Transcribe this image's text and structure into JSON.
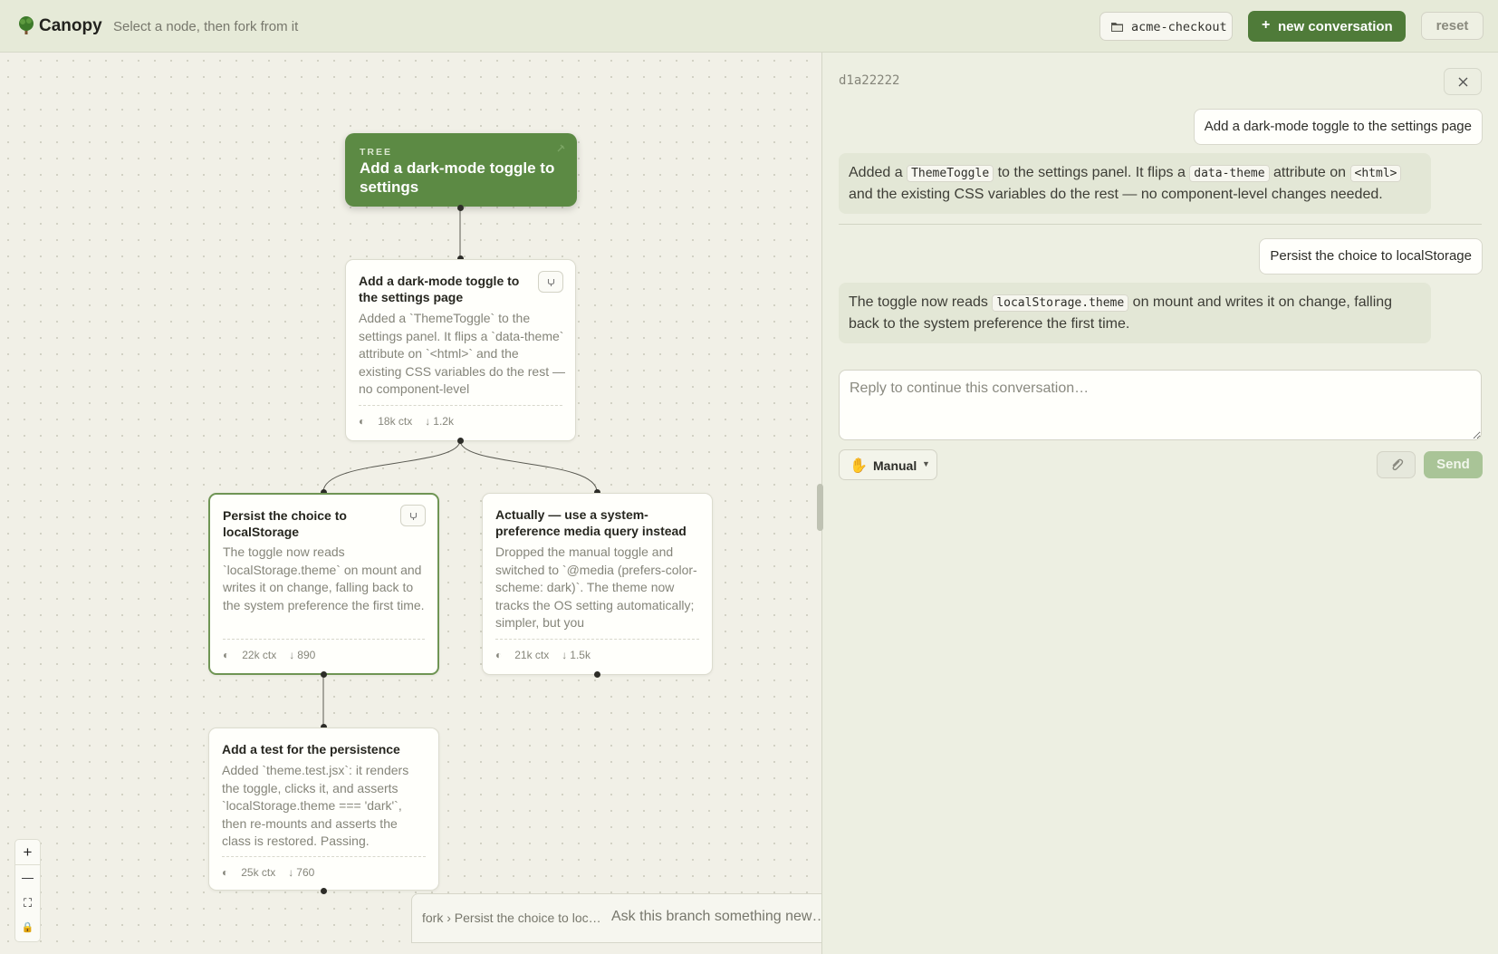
{
  "header": {
    "app_name": "Canopy",
    "hint": "Select a node, then fork from it",
    "repo_label": "acme-checkout",
    "new_conversation_label": "new conversation",
    "new_conversation_icon": "+",
    "reset_label": "reset",
    "logo_icon": "tree-icon"
  },
  "tree": {
    "root": {
      "tag": "TREE",
      "title": "Add a dark-mode toggle to settings"
    },
    "nodes": [
      {
        "title": "Add a dark-mode toggle to the settings page",
        "body": "Added a `ThemeToggle` to the settings panel. It flips a `data-theme` attribute on `<html>` and the existing CSS variables do the rest — no component-level",
        "ctx": "18k ctx",
        "tokens": "1.2k"
      },
      {
        "title": "Persist the choice to localStorage",
        "body": "The toggle now reads `localStorage.theme` on mount and writes it on change, falling back to the system preference the first time.",
        "ctx": "22k ctx",
        "tokens": "890",
        "selected": true
      },
      {
        "title": "Actually — use a system-preference media query instead",
        "body": "Dropped the manual toggle and switched to `@media (prefers-color-scheme: dark)`. The theme now tracks the OS setting automatically; simpler, but you",
        "ctx": "21k ctx",
        "tokens": "1.5k"
      },
      {
        "title": "Add a test for the persistence",
        "body": "Added `theme.test.jsx`: it renders the toggle, clicks it, and asserts `localStorage.theme === 'dark'`, then re-mounts and asserts the class is restored. Passing.",
        "ctx": "25k ctx",
        "tokens": "760"
      }
    ],
    "zoom_controls": [
      "+",
      "—",
      "⛶",
      "🔒"
    ],
    "fork_bar": {
      "crumb": "fork › Persist the choice to loc…",
      "placeholder": "Ask this branch something new…"
    }
  },
  "panel": {
    "conversation_id": "d1a22222",
    "messages": [
      {
        "role": "user",
        "text": "Add a dark-mode toggle to the settings page"
      },
      {
        "role": "assistant",
        "t1": "Added a ",
        "c1": "ThemeToggle",
        "t2": " to the settings panel. It flips a ",
        "c2": "data-theme",
        "t3": " attribute on ",
        "c3": "<html>",
        "t4": " and the existing CSS variables do the rest — no component-level changes needed."
      },
      {
        "role": "user",
        "text": "Persist the choice to localStorage"
      },
      {
        "role": "assistant",
        "t1": "The toggle now reads ",
        "c1": "localStorage.theme",
        "t2": " on mount and writes it on change, falling back to the system preference the first time."
      }
    ],
    "reply_placeholder": "Reply to continue this conversation…",
    "mode_label": "Manual",
    "mode_icon": "✋",
    "send_label": "Send"
  },
  "colors": {
    "accent": "#4f7b39",
    "root_node": "#5c8a44",
    "selected_border": "#6f9554",
    "send_disabled": "#a9c497"
  }
}
